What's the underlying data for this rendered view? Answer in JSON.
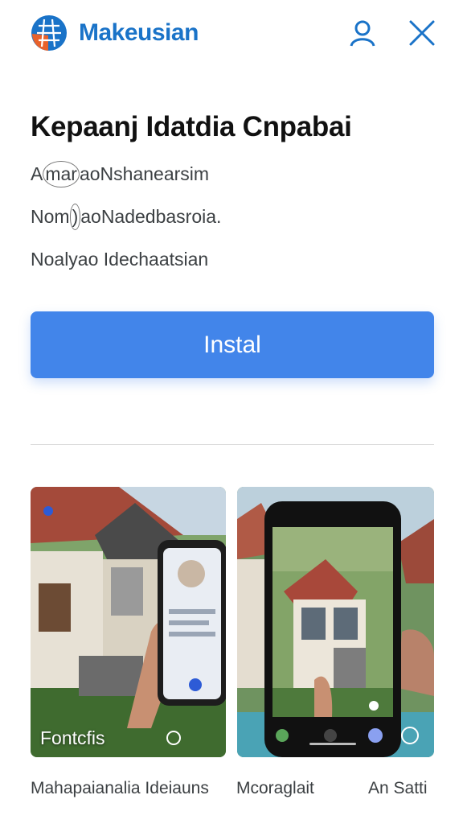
{
  "header": {
    "brand": "Makeusian",
    "profile_icon": "person-icon",
    "close_icon": "close-icon"
  },
  "app": {
    "title": "Kepaanj Idatdia Cnpabai",
    "meta": [
      {
        "prefix": "A",
        "circled": "mar",
        "rest": "aoNshanearsim"
      },
      {
        "prefix": "Nom",
        "circled": ")",
        "rest": "aoNadedbasroia."
      },
      {
        "prefix": "Noalyao",
        "circled": "",
        "rest": " Idechaatsian"
      }
    ]
  },
  "install_label": "Instal",
  "screenshots": [
    {
      "label": "Fontcfis"
    },
    {
      "label": ""
    }
  ],
  "captions": [
    "Mahapaianalia Ideiauns",
    "Mcoraglait",
    "An Satti"
  ],
  "colors": {
    "accent": "#4285ea",
    "brand": "#1a73c8",
    "logo_orange": "#e8622c"
  }
}
